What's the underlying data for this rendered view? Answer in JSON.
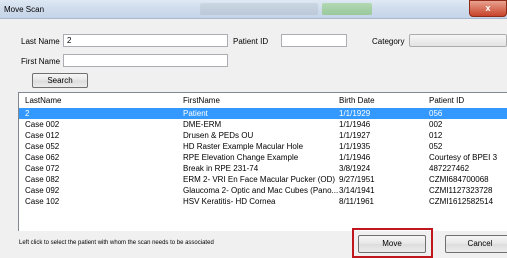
{
  "window": {
    "title": "Move Scan",
    "close_glyph": "x"
  },
  "form": {
    "last_name_label": "Last Name",
    "last_name_value": "2",
    "patient_id_label": "Patient ID",
    "patient_id_value": "",
    "category_label": "Category",
    "category_value": "",
    "first_name_label": "First Name",
    "first_name_value": "",
    "search_label": "Search"
  },
  "table": {
    "columns": [
      "LastName",
      "FirstName",
      "Birth Date",
      "Patient ID"
    ],
    "rows": [
      [
        "2",
        "Patient",
        "1/1/1929",
        "056"
      ],
      [
        "Case 002",
        "DME-ERM",
        "1/1/1946",
        "002"
      ],
      [
        "Case 012",
        "Drusen & PEDs OU",
        "1/1/1927",
        "012"
      ],
      [
        "Case 052",
        "HD Raster Example Macular Hole",
        "1/1/1935",
        "052"
      ],
      [
        "Case 062",
        "RPE Elevation Change Example",
        "1/1/1946",
        "Courtesy of BPEI 3"
      ],
      [
        "Case 072",
        "Break in RPE 231-74",
        "3/8/1924",
        "487227462"
      ],
      [
        "Case 082",
        "ERM 2- VRI En Face Macular Pucker (OD)",
        "9/27/1951",
        "CZMI684700068"
      ],
      [
        "Case 092",
        "Glaucoma 2- Optic and Mac Cubes (Pano...",
        "3/14/1941",
        "CZMI1127323728"
      ],
      [
        "Case 102",
        "HSV Keratitis- HD Cornea",
        "8/11/1961",
        "CZMI1612582514"
      ]
    ],
    "selected_row": 0
  },
  "footer": {
    "hint": "Left click to select the patient with whom the scan needs to be associated",
    "move_label": "Move",
    "cancel_label": "Cancel"
  },
  "colors": {
    "selection": "#3399ff",
    "highlight": "#c0171f"
  }
}
